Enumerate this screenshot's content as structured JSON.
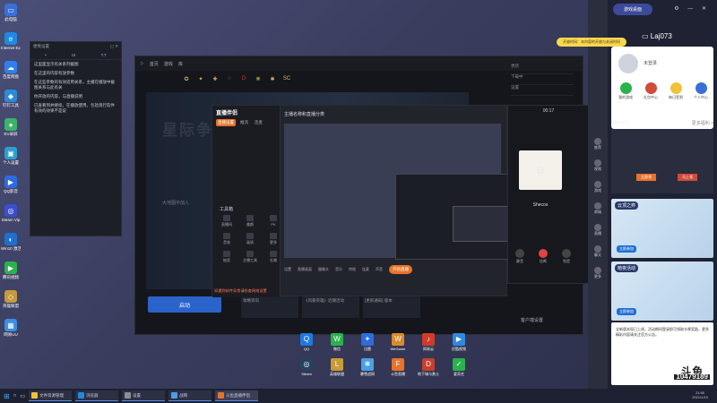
{
  "desktop_icons": [
    {
      "label": "此电脑",
      "color": "#3a6fd8",
      "glyph": "▭"
    },
    {
      "label": "Internet Explorer",
      "color": "#1e8ae6",
      "glyph": "e"
    },
    {
      "label": "百度网盘",
      "color": "#2f80ed",
      "glyph": "☁"
    },
    {
      "label": "钉钉工具",
      "color": "#2a8bd6",
      "glyph": "◆"
    },
    {
      "label": "EV录屏",
      "color": "#3bb36a",
      "glyph": "●"
    },
    {
      "label": "个人设置",
      "color": "#2a9fd0",
      "glyph": "▣"
    },
    {
      "label": "QQ影音",
      "color": "#2d6cdf",
      "glyph": "▶"
    },
    {
      "label": "Steam Vip",
      "color": "#3a4fd0",
      "glyph": "◎"
    },
    {
      "label": "Win10 激活",
      "color": "#1f6fd1",
      "glyph": "◐"
    },
    {
      "label": "腾讯视频",
      "color": "#2bb24c",
      "glyph": "▶"
    },
    {
      "label": "英雄联盟",
      "color": "#c39a3c",
      "glyph": "◇"
    },
    {
      "label": "网易UU",
      "color": "#3a8fe0",
      "glyph": "▦"
    }
  ],
  "notepad": {
    "title": "便笺设置",
    "tabs": [
      "•",
      "UI",
      "T.T"
    ],
    "lines": [
      "这里面显示有关系列截图",
      "在这里的内容有放参数",
      "在这些参数的有效适用关系，主播在播放中截图关系与此有关",
      "你开放的内容，与直播说明",
      "已查看到并继续，在播放使用，包括现行软件有效的效果不是说"
    ]
  },
  "game_launcher": {
    "nav": [
      "首页",
      "游戏",
      "库"
    ],
    "banner_title": "星际争霸",
    "start_label": "启动",
    "search_hint": "大地图中加入",
    "right_rows": [
      "更新",
      "下载中",
      "设置"
    ],
    "news": [
      "攻略资讯",
      "《风暴英雄》近期活动",
      "[更新通知] 版本"
    ],
    "bottom_link": "客户端设置"
  },
  "obs": {
    "logo": "直播伴侣",
    "tabs": [
      "直播设置",
      "推流",
      "连麦"
    ],
    "capture_title": "主播名称和直播分类",
    "tool_heading": "工具箱",
    "tools": [
      "直播间",
      "美颜",
      "PK",
      "音效",
      "画质",
      "更多",
      "抽奖",
      "主播工具",
      "礼物"
    ],
    "bottom_tools": [
      "设置",
      "直播画面",
      "摄像头",
      "音乐",
      "特效",
      "连麦",
      "声音"
    ],
    "live_button": "开始直播",
    "warning": "如遇到软件异常请检查网络设置"
  },
  "call_window": {
    "timer": "00:17",
    "name": "Shecos",
    "buttons": [
      "静音",
      "挂断",
      "免提"
    ]
  },
  "tray_apps": [
    {
      "label": "QQ",
      "color": "#1f7ae0",
      "glyph": "Q"
    },
    {
      "label": "微信",
      "color": "#2bb24c",
      "glyph": "W"
    },
    {
      "label": "迅雷",
      "color": "#2a6de0",
      "glyph": "✦"
    },
    {
      "label": "WeGame",
      "color": "#d98b2b",
      "glyph": "W"
    },
    {
      "label": "网易云",
      "color": "#d43a2a",
      "glyph": "♪"
    },
    {
      "label": "优酷视频",
      "color": "#2d8ae0",
      "glyph": "▶"
    },
    {
      "label": "Steam",
      "color": "#27415f",
      "glyph": "◎"
    },
    {
      "label": "英雄联盟",
      "color": "#c99b38",
      "glyph": "L"
    },
    {
      "label": "暴雪战网",
      "color": "#4aa0e8",
      "glyph": "❋"
    },
    {
      "label": "斗鱼直播",
      "color": "#e8722a",
      "glyph": "F"
    },
    {
      "label": "地下城与勇士",
      "color": "#c6402b",
      "glyph": "D"
    },
    {
      "label": "爱奇艺",
      "color": "#2bb24c",
      "glyph": "✓"
    }
  ],
  "right_sidebar": [
    "推荐",
    "视频",
    "游戏",
    "商城",
    "直播",
    "聊天",
    "更多"
  ],
  "right_panel": {
    "game_desk_label": "游戏桌面",
    "username": "Laj073",
    "tip": "开放时间：本内容的开放与关闭时间",
    "login_text": "未登录",
    "quick": [
      {
        "label": "我的游戏",
        "color": "#2bb24c"
      },
      {
        "label": "礼包中心",
        "color": "#d04b3a"
      },
      {
        "label": "每日签到",
        "color": "#f0c23a"
      },
      {
        "label": "个人中心",
        "color": "#3a6fd8"
      }
    ],
    "section_title": "福利专区",
    "section_more": "更多福利 >",
    "ad_labels": [
      "立即领",
      "马上领"
    ],
    "promos": [
      {
        "title": "云顶之弈",
        "button": "立即参加"
      },
      {
        "title": "暗夜活动",
        "button": "立即参加"
      }
    ],
    "announce": "全新版本现已上线，活动期间登录即可领取丰厚奖励，更多精彩内容请关注官方公告。",
    "watermark_big": "斗鱼",
    "watermark_num": "10479189"
  },
  "taskbar": {
    "items": [
      {
        "label": "文件资源管理",
        "color": "#f0c23a"
      },
      {
        "label": "浏览器",
        "color": "#1e8ae6"
      },
      {
        "label": "设置",
        "color": "#8a8e98"
      },
      {
        "label": "战网",
        "color": "#4aa0e8"
      },
      {
        "label": "斗鱼直播伴侣",
        "color": "#e8722a"
      }
    ],
    "time": "21:50",
    "date": "2021/1/10"
  }
}
